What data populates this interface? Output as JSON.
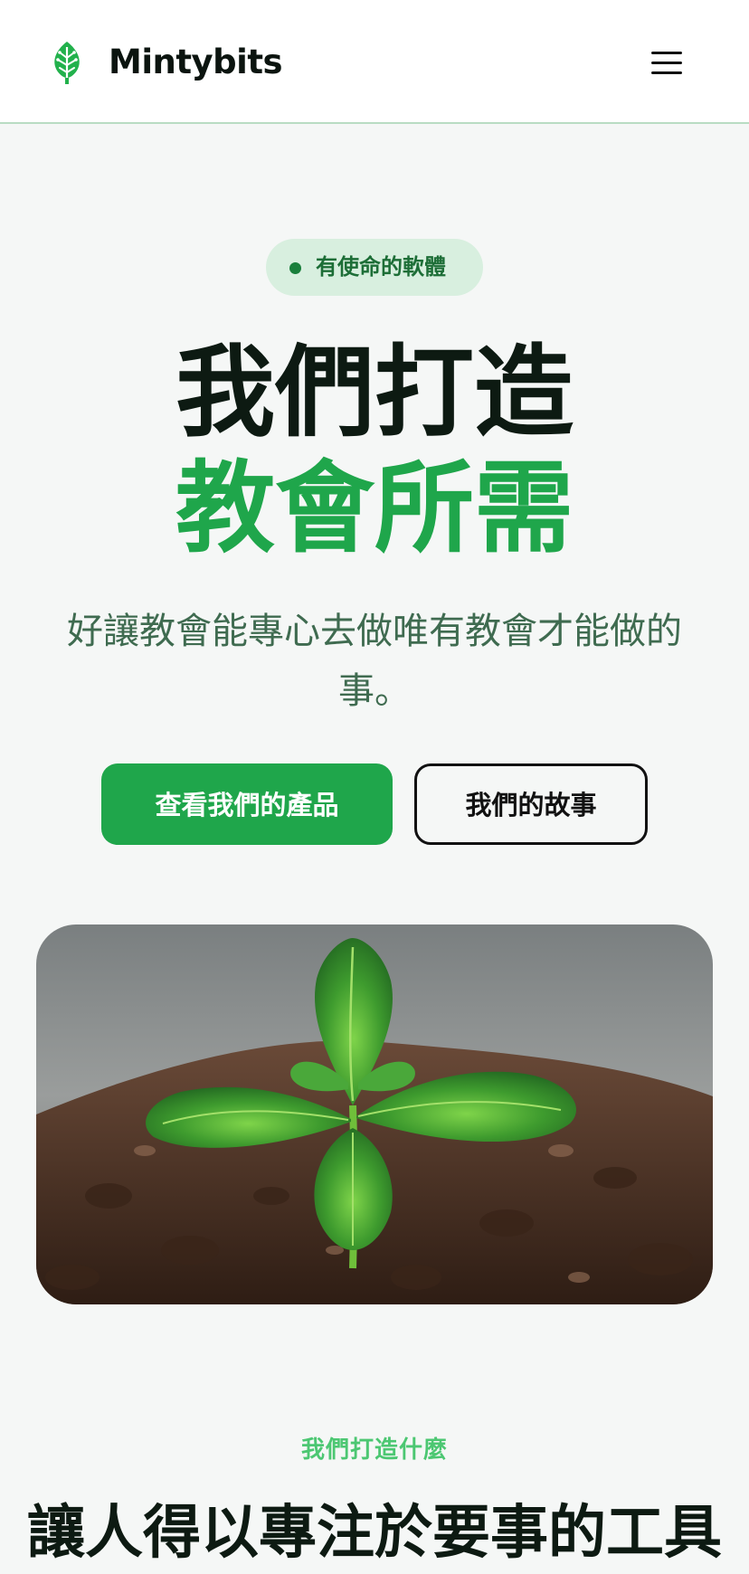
{
  "header": {
    "brand": "Mintybits",
    "logo_icon": "leaf-icon",
    "menu_icon": "hamburger-menu-icon"
  },
  "hero": {
    "badge": "有使命的軟體",
    "title_line1": "我們打造",
    "title_line2": "教會所需",
    "subtitle": "好讓教會能專心去做唯有教會才能做的事。",
    "primary_button": "查看我們的產品",
    "secondary_button": "我們的故事",
    "image_alt": "mint seedling in soil"
  },
  "section": {
    "label": "我們打造什麼",
    "title": "讓人得以專注於要事的工具"
  },
  "colors": {
    "accent": "#1fa64b",
    "badge_bg": "#d8efdf",
    "page_bg": "#f5f7f6",
    "text_dark": "#0d1a12"
  }
}
